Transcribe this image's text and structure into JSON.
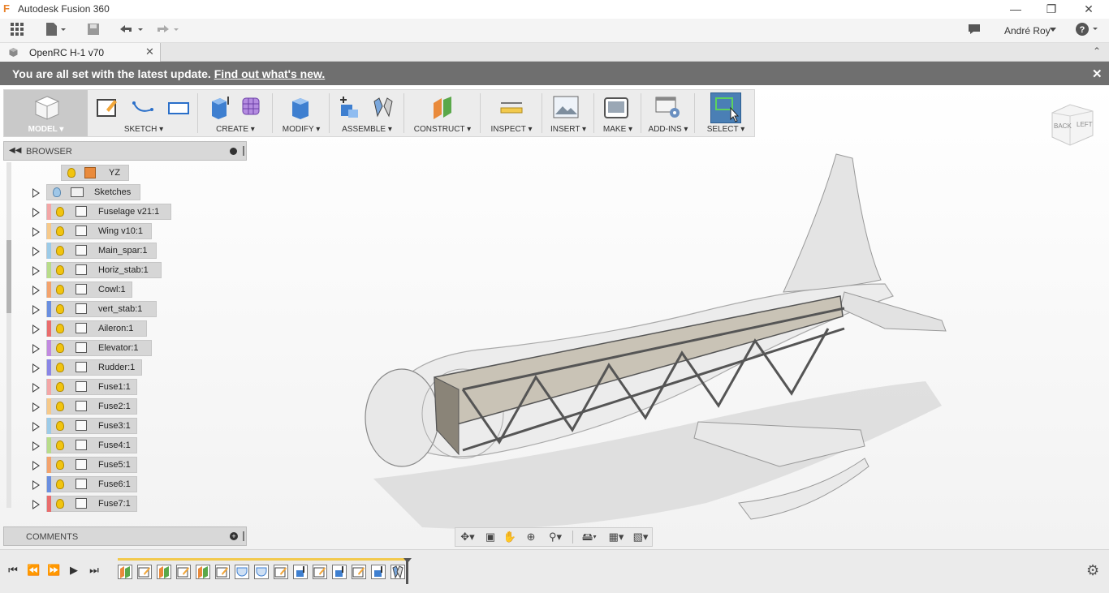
{
  "app": {
    "title": "Autodesk Fusion 360",
    "user": "André Roy"
  },
  "tab": {
    "name": "OpenRC H-1 v70"
  },
  "banner": {
    "message": "You are all set with the latest update.",
    "link": "Find out what's new."
  },
  "toolbar": {
    "workspace": "MODEL",
    "groups": [
      {
        "label": "SKETCH"
      },
      {
        "label": "CREATE"
      },
      {
        "label": "MODIFY"
      },
      {
        "label": "ASSEMBLE"
      },
      {
        "label": "CONSTRUCT"
      },
      {
        "label": "INSPECT"
      },
      {
        "label": "INSERT"
      },
      {
        "label": "MAKE"
      },
      {
        "label": "ADD-INS"
      },
      {
        "label": "SELECT"
      }
    ]
  },
  "browser": {
    "title": "BROWSER",
    "yz": "YZ",
    "sketches": "Sketches",
    "items": [
      {
        "label": "Fuselage v21:1",
        "color": "#f3a7a7"
      },
      {
        "label": "Wing v10:1",
        "color": "#f6c98a"
      },
      {
        "label": "Main_spar:1",
        "color": "#9ccbe8"
      },
      {
        "label": "Horiz_stab:1",
        "color": "#b8dc8a"
      },
      {
        "label": "Cowl:1",
        "color": "#f3a36d"
      },
      {
        "label": "vert_stab:1",
        "color": "#6a8fe0"
      },
      {
        "label": "Aileron:1",
        "color": "#e96d6d"
      },
      {
        "label": "Elevator:1",
        "color": "#c18ae0"
      },
      {
        "label": "Rudder:1",
        "color": "#8a86e6"
      },
      {
        "label": "Fuse1:1",
        "color": "#f3a7a7"
      },
      {
        "label": "Fuse2:1",
        "color": "#f6c98a"
      },
      {
        "label": "Fuse3:1",
        "color": "#9ccbe8"
      },
      {
        "label": "Fuse4:1",
        "color": "#b8dc8a"
      },
      {
        "label": "Fuse5:1",
        "color": "#f3a36d"
      },
      {
        "label": "Fuse6:1",
        "color": "#6a8fe0"
      },
      {
        "label": "Fuse7:1",
        "color": "#e96d6d"
      }
    ]
  },
  "comments": {
    "title": "COMMENTS"
  },
  "viewcube": {
    "back": "BACK",
    "left": "LEFT"
  },
  "colors": {
    "banner": "#6f6f6f",
    "select_active": "#4a7fb5",
    "timeline_marker": "#f2c94c"
  }
}
